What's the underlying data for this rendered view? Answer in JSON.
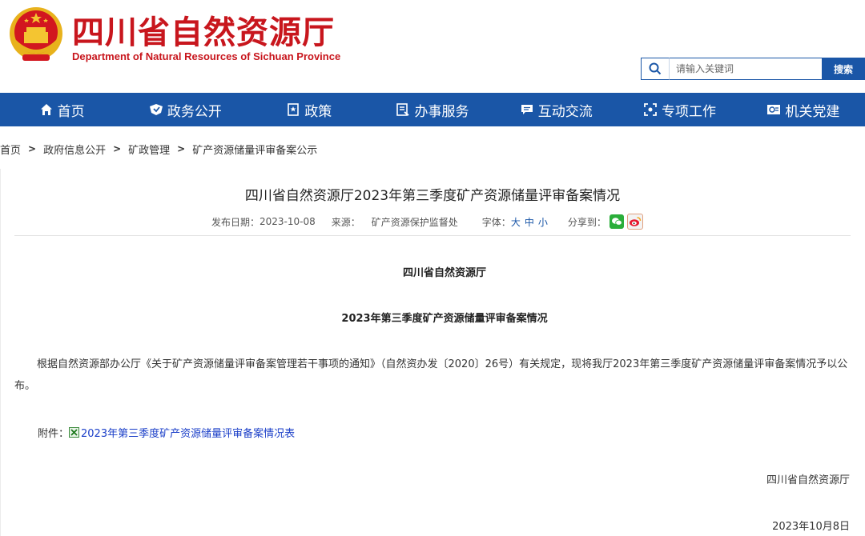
{
  "header": {
    "site_name": "四川省自然资源厅",
    "site_name_en": "Department of Natural Resources of Sichuan Province"
  },
  "search": {
    "placeholder": "请输入关键词",
    "button_label": "搜索"
  },
  "nav": {
    "items": [
      {
        "label": "首页",
        "icon": "home-icon"
      },
      {
        "label": "政务公开",
        "icon": "shield-icon"
      },
      {
        "label": "政策",
        "icon": "document-icon"
      },
      {
        "label": "办事服务",
        "icon": "form-icon"
      },
      {
        "label": "互动交流",
        "icon": "chat-icon"
      },
      {
        "label": "专项工作",
        "icon": "focus-icon"
      },
      {
        "label": "机关党建",
        "icon": "party-icon"
      }
    ],
    "color": "#1a56a7"
  },
  "breadcrumb": {
    "items": [
      "首页",
      "政府信息公开",
      "矿政管理",
      "矿产资源储量评审备案公示"
    ],
    "separator": ">"
  },
  "article": {
    "title": "四川省自然资源厅2023年第三季度矿产资源储量评审备案情况",
    "publish_label": "发布日期：",
    "publish_date": "2023-10-08",
    "source_label": "来源：",
    "source": "矿产资源保护监督处",
    "font_label": "字体：",
    "font_sizes": [
      "大",
      "中",
      "小"
    ],
    "share_label": "分享到：",
    "body_title1": "四川省自然资源厅",
    "body_title2": "2023年第三季度矿产资源储量评审备案情况",
    "paragraph": "根据自然资源部办公厅《关于矿产资源储量评审备案管理若干事项的通知》（自然资办发〔2020〕26号）有关规定，现将我厅2023年第三季度矿产资源储量评审备案情况予以公布。",
    "attachment_label": "附件：",
    "attachment_link": "2023年第三季度矿产资源储量评审备案情况表",
    "sign_org": "四川省自然资源厅",
    "sign_date": "2023年10月8日"
  },
  "colors": {
    "brand_red": "#c8161d",
    "brand_blue": "#1a56a7",
    "link_blue": "#1a3ec8"
  }
}
